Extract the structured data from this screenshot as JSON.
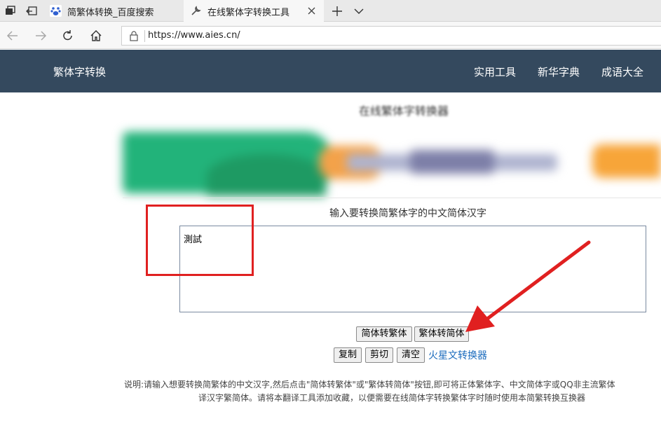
{
  "browser": {
    "tabs": [
      {
        "title": "简繁体转换_百度搜索",
        "active": false
      },
      {
        "title": "在线繁体字转换工具",
        "active": true
      }
    ],
    "url": "https://www.aies.cn/"
  },
  "site": {
    "brand": "繁体字转换",
    "nav": [
      "实用工具",
      "新华字典",
      "成语大全"
    ],
    "page_title": "在线繁体字转换器"
  },
  "form": {
    "prompt": "输入要转换简繁体字的中文简体汉字",
    "input_value": "測試",
    "buttons": {
      "to_traditional": "简体转繁体",
      "to_simplified": "繁体转简体",
      "copy": "复制",
      "cut": "剪切",
      "clear": "清空"
    },
    "link": "火星文转换器"
  },
  "description": {
    "line1": "说明:请输入想要转换简繁体的中文汉字,然后点击\"简体转繁体\"或\"繁体转简体\"按钮,即可将正体繁体字、中文简体字或QQ非主流繁体",
    "line2": "译汉字繁简体。请将本翻译工具添加收藏，以便需要在线简体字转换繁体字时随时使用本简繁转换互换器"
  },
  "colors": {
    "header_bg": "#34495e",
    "link": "#1a6bbd",
    "annotation": "#e02020"
  }
}
